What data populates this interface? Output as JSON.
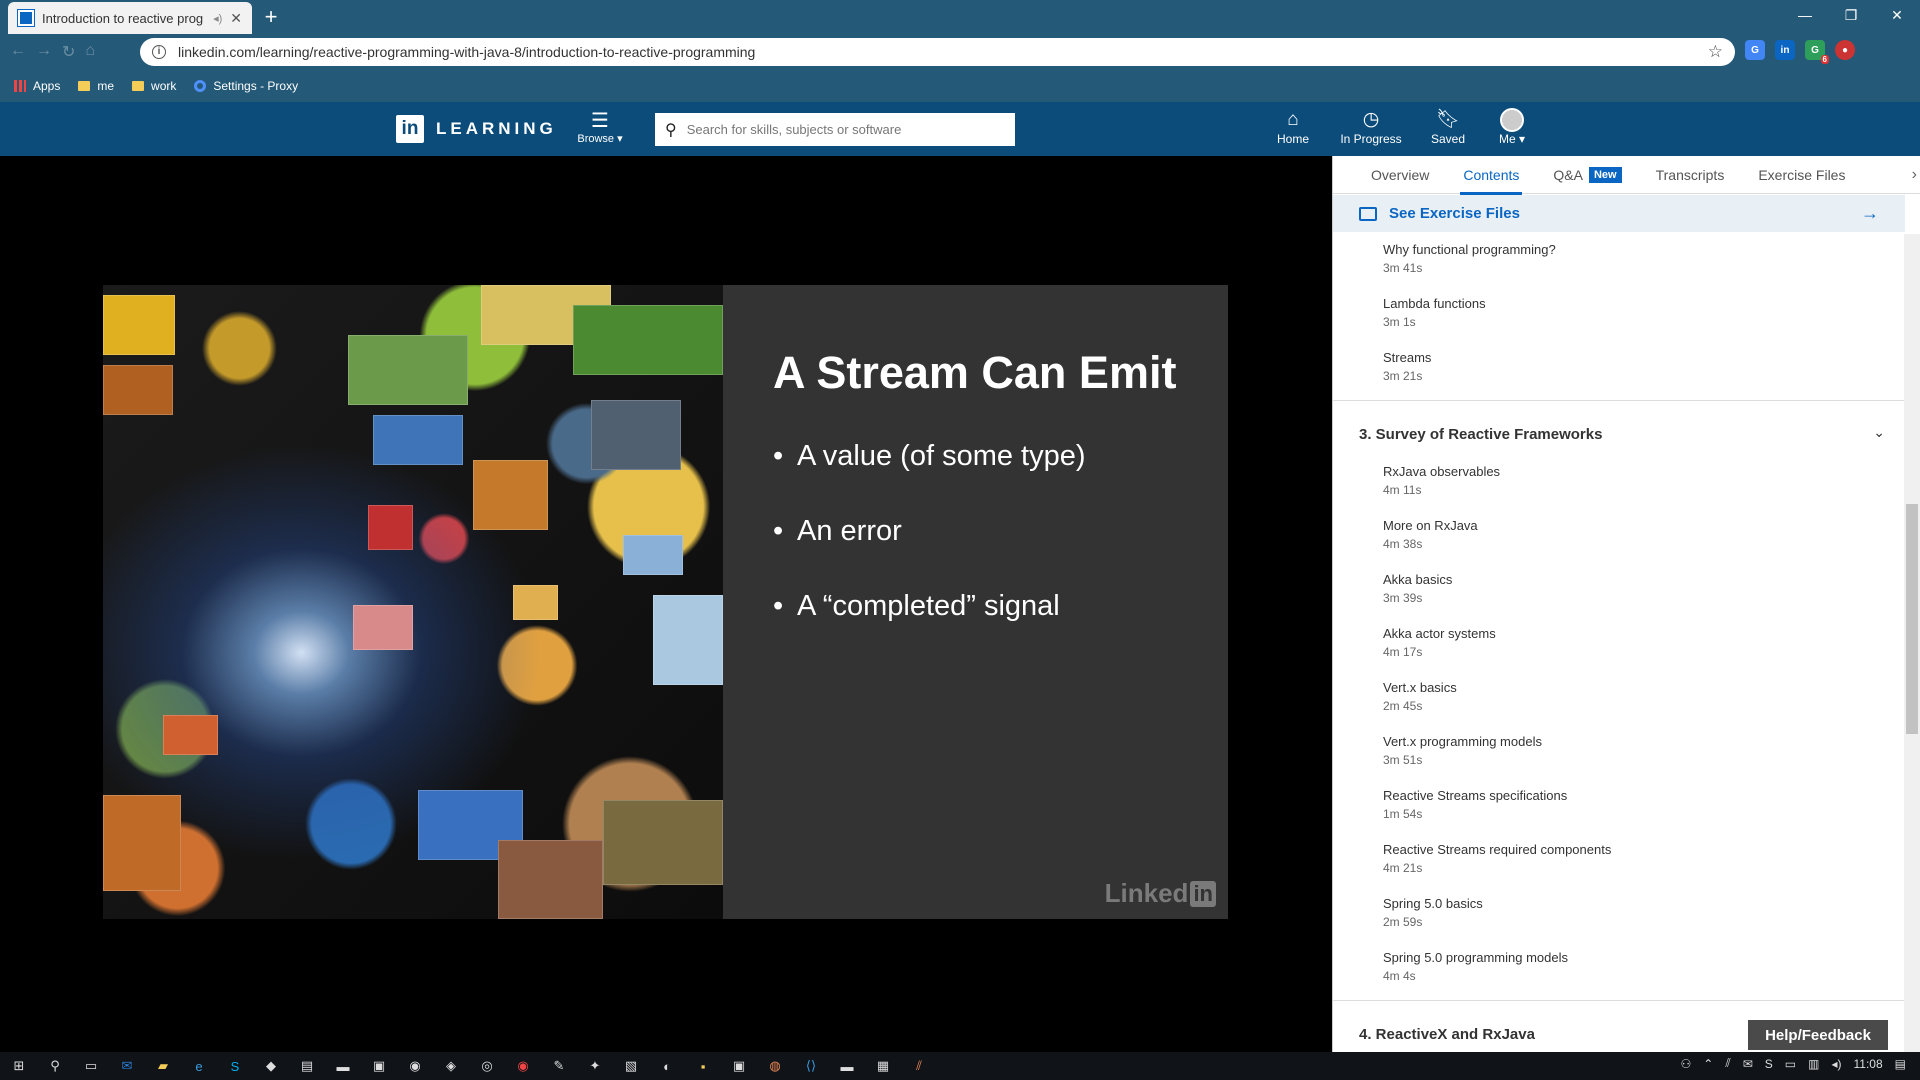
{
  "browser": {
    "tab_title": "Introduction to reactive prog",
    "url": "linkedin.com/learning/reactive-programming-with-java-8/introduction-to-reactive-programming",
    "bookmarks": [
      {
        "label": "Apps",
        "icon": "apps-grid-icon"
      },
      {
        "label": "me",
        "icon": "folder-icon"
      },
      {
        "label": "work",
        "icon": "folder-icon"
      },
      {
        "label": "Settings - Proxy",
        "icon": "gear-icon"
      }
    ],
    "extension_badge": "6"
  },
  "header": {
    "logo_mark": "in",
    "logo_word": "LEARNING",
    "browse_label": "Browse",
    "search_placeholder": "Search for skills, subjects or software",
    "nav": {
      "home": "Home",
      "in_progress": "In Progress",
      "saved": "Saved",
      "me": "Me"
    }
  },
  "slide": {
    "title": "A Stream Can Emit",
    "bullets": [
      "A value (of some type)",
      "An error",
      "A “completed” signal"
    ],
    "watermark_word": "Linked",
    "watermark_box": "in"
  },
  "panel": {
    "tabs": {
      "overview": "Overview",
      "contents": "Contents",
      "qa": "Q&A",
      "qa_badge": "New",
      "transcripts": "Transcripts",
      "exercise_files": "Exercise Files"
    },
    "see_exercise_files": "See Exercise Files",
    "prev_items": [
      {
        "title": "Why functional programming?",
        "duration": "3m 41s"
      },
      {
        "title": "Lambda functions",
        "duration": "3m 1s"
      },
      {
        "title": "Streams",
        "duration": "3m 21s"
      }
    ],
    "section3": {
      "title": "3. Survey of Reactive Frameworks",
      "items": [
        {
          "title": "RxJava observables",
          "duration": "4m 11s"
        },
        {
          "title": "More on RxJava",
          "duration": "4m 38s"
        },
        {
          "title": "Akka basics",
          "duration": "3m 39s"
        },
        {
          "title": "Akka actor systems",
          "duration": "4m 17s"
        },
        {
          "title": "Vert.x basics",
          "duration": "2m 45s"
        },
        {
          "title": "Vert.x programming models",
          "duration": "3m 51s"
        },
        {
          "title": "Reactive Streams specifications",
          "duration": "1m 54s"
        },
        {
          "title": "Reactive Streams required components",
          "duration": "4m 21s"
        },
        {
          "title": "Spring 5.0 basics",
          "duration": "2m 59s"
        },
        {
          "title": "Spring 5.0 programming models",
          "duration": "4m 4s"
        }
      ]
    },
    "section4_title": "4. ReactiveX and RxJava",
    "help_button": "Help/Feedback"
  },
  "taskbar": {
    "time": "11:08"
  }
}
